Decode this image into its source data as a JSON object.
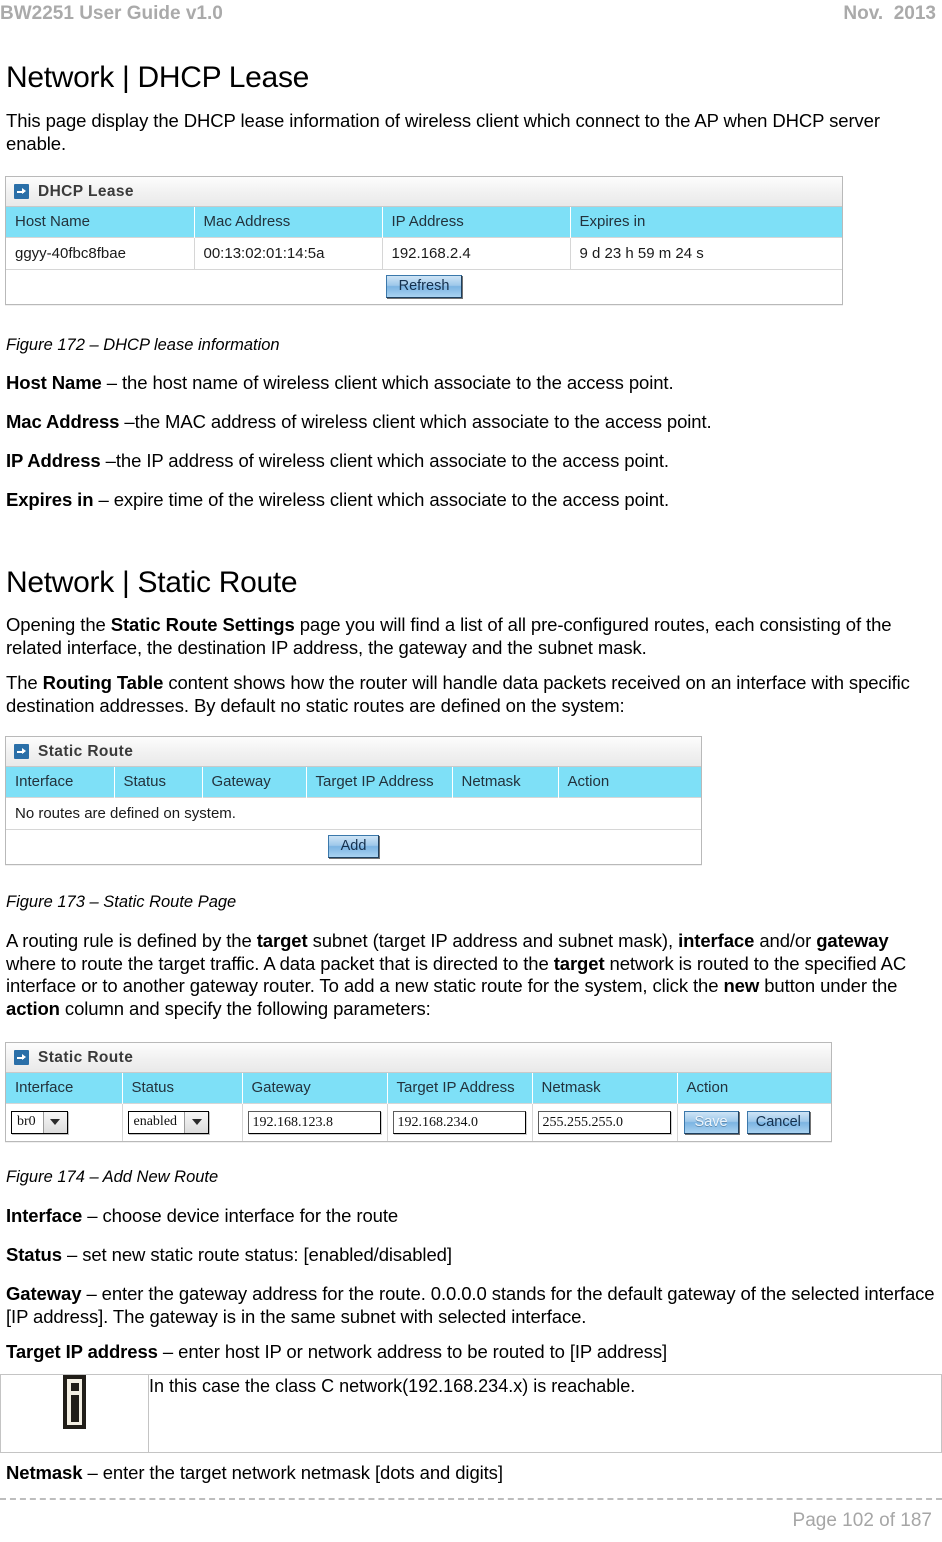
{
  "header": {
    "left": "BW2251 User Guide v1.0",
    "right": "Nov.  2013"
  },
  "footer": {
    "page_label": "Page 102 of 187"
  },
  "dhcp_section": {
    "title": "Network | DHCP Lease",
    "intro": "This page display the DHCP lease information of wireless client which connect to the AP when DHCP server enable.",
    "figure_caption": "Figure 172 – DHCP lease information",
    "panel": {
      "panel_title": "DHCP Lease",
      "columns": [
        "Host Name",
        "Mac Address",
        "IP Address",
        "Expires in"
      ],
      "rows": [
        [
          "ggyy-40fbc8fbae",
          "00:13:02:01:14:5a",
          "192.168.2.4",
          "9 d 23 h 59 m 24 s"
        ]
      ],
      "refresh_label": "Refresh"
    },
    "definitions": [
      {
        "term": "Host Name",
        "rest": " – the host name of wireless client which associate to the access point."
      },
      {
        "term": "Mac Address",
        "rest": " –the MAC address of wireless client which associate to the access point."
      },
      {
        "term": "IP Address",
        "rest": " –the IP address of wireless client which associate to the access point."
      },
      {
        "term": "Expires in",
        "rest": " – expire time of the wireless client which associate to the access point."
      }
    ]
  },
  "static_route_section": {
    "title": "Network | Static Route",
    "para1": {
      "a": "Opening the ",
      "b": "Static Route Settings",
      "c": " page you will find a list of all pre-configured routes, each consisting of the related interface, the destination IP address, the gateway and the subnet mask."
    },
    "para2": {
      "a": "The ",
      "b": "Routing Table",
      "c": " content shows how the router will handle data packets received on an interface with specific destination addresses. By default no static routes are defined on the system:"
    },
    "figure_173_caption": "Figure 173 – Static Route Page",
    "list_panel": {
      "panel_title": "Static Route",
      "columns": [
        "Interface",
        "Status",
        "Gateway",
        "Target IP Address",
        "Netmask",
        "Action"
      ],
      "empty_message": "No routes are defined on system.",
      "add_label": "Add"
    },
    "para3": {
      "p1": "A routing rule is defined by the ",
      "b1": "target",
      "p2": " subnet (target IP address and subnet mask), ",
      "b2": "interface",
      "p3": " and/or ",
      "b3": "gateway",
      "p4": " where to route the target traffic. A data packet that is directed to the ",
      "b4": "target",
      "p5": " network is routed to the specified AC interface or to another gateway router. To add a new static route for the system, click the ",
      "b5": "new",
      "p6": " button under the ",
      "b6": "action",
      "p7": " column and specify the following parameters:"
    },
    "figure_174_caption": "Figure 174 – Add New Route",
    "add_panel": {
      "panel_title": "Static Route",
      "columns": [
        "Interface",
        "Status",
        "Gateway",
        "Target IP Address",
        "Netmask",
        "Action"
      ],
      "interface_value": "br0",
      "status_value": "enabled",
      "gateway_value": "192.168.123.8",
      "target_ip_value": "192.168.234.0",
      "netmask_value": "255.255.255.0",
      "save_label": "Save",
      "cancel_label": "Cancel"
    },
    "definitions": [
      {
        "term": "Interface",
        "rest": " – choose device interface for the route"
      },
      {
        "term": "Status",
        "rest": " – set new static route status: [enabled/disabled]"
      },
      {
        "term": "Gateway",
        "rest": " – enter the gateway address for the route. 0.0.0.0 stands for the default gateway of the selected interface [IP address]. The gateway is in the same subnet with selected interface."
      },
      {
        "term": "Target IP address",
        "rest": " – enter host IP or network address to be routed to [IP address]"
      }
    ],
    "note": {
      "text": "In this case the class C network(192.168.234.x) is reachable."
    },
    "netmask_def": {
      "term": "Netmask",
      "rest": " – enter the target network netmask [dots and digits]"
    }
  },
  "colors": {
    "table_header_bg": "#7ee0f7",
    "icon_blue": "#2a6fa8",
    "header_gray": "#aaaaaa"
  }
}
